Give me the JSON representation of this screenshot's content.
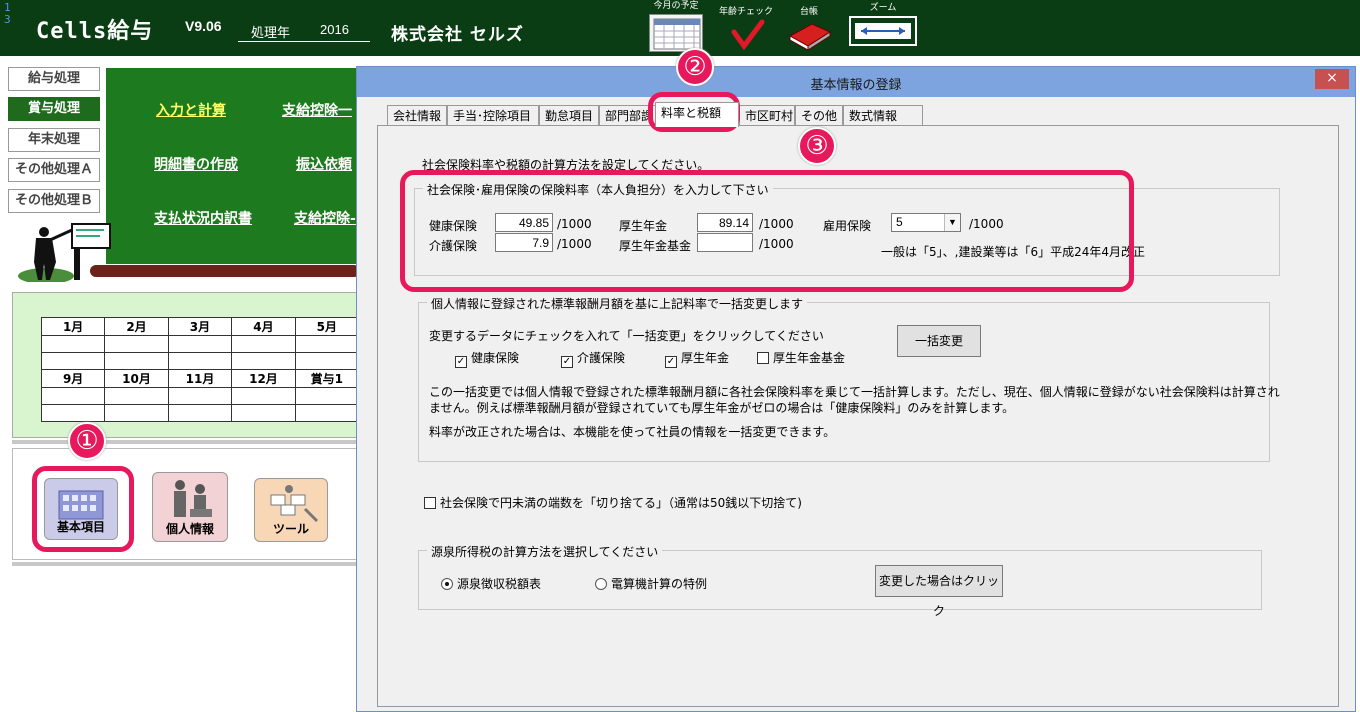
{
  "app": {
    "row_numbers": [
      "1",
      "3"
    ],
    "title": "Cells給与",
    "version": "V9.06",
    "year_label": "処理年",
    "year_value": "2016",
    "company": "株式会社 セルズ"
  },
  "toolbar": {
    "schedule_label": "今月の予定",
    "age_check_label": "年齢チェック",
    "ledger_label": "台帳",
    "zoom_label": "ズーム"
  },
  "nav": {
    "payroll": "給与処理",
    "bonus": "賞与処理",
    "yearend": "年末処理",
    "otherA": "その他処理Ａ",
    "otherB": "その他処理Ｂ"
  },
  "board": {
    "input_calc": "入力と計算",
    "ded_list": "支給控除一",
    "meisai": "明細書の作成",
    "furikomi": "振込依頼",
    "shiharai": "支払状況内訳書",
    "ded2": "支給控除-"
  },
  "calendar": {
    "row1": [
      "1月",
      "2月",
      "3月",
      "4月",
      "5月"
    ],
    "row2": [
      "9月",
      "10月",
      "11月",
      "12月",
      "賞与1"
    ]
  },
  "icons": {
    "kihon": "基本項目",
    "kojin": "個人情報",
    "tool": "ツール"
  },
  "callouts": {
    "n1": "①",
    "n2": "②",
    "n3": "③"
  },
  "dialog": {
    "title": "基本情報の登録",
    "close": "×",
    "tabs": [
      "会社情報",
      "手当･控除項目",
      "勤怠項目",
      "部門部課",
      "料率と税額",
      "市区町村",
      "その他",
      "数式情報"
    ],
    "intro": "社会保険料率や税額の計算方法を設定してください。",
    "rates": {
      "legend": "社会保険･雇用保険の保険料率（本人負担分）を入力して下さい",
      "health_label": "健康保険",
      "health_value": "49.85",
      "care_label": "介護保険",
      "care_value": "7.9",
      "pension_label": "厚生年金",
      "pension_value": "89.14",
      "fund_label": "厚生年金基金",
      "fund_value": "",
      "employ_label": "雇用保険",
      "employ_value": "5",
      "unit": "/1000",
      "employ_note": "一般は「5」、,建設業等は「6」平成24年4月改正"
    },
    "bulk": {
      "legend": "個人情報に登録された標準報酬月額を基に上記料率で一括変更します",
      "instruction": "変更するデータにチェックを入れて「一括変更」をクリックしてください",
      "checks": [
        {
          "label": "健康保険",
          "checked": true
        },
        {
          "label": "介護保険",
          "checked": true
        },
        {
          "label": "厚生年金",
          "checked": true
        },
        {
          "label": "厚生年金基金",
          "checked": false
        }
      ],
      "button": "一括変更",
      "note1": "この一括変更では個人情報で登録された標準報酬月額に各社会保険料率を乗じて一括計算します。ただし、現在、個人情報に登録がない社会保険料は計算され",
      "note2": "ません。例えば標準報酬月額が登録されていても厚生年金がゼロの場合は「健康保険料」のみを計算します。",
      "note3": "料率が改正された場合は、本機能を使って社員の情報を一括変更できます。"
    },
    "round_check": "社会保険で円未満の端数を「切り捨てる」（通常は50銭以下切捨て)",
    "tax": {
      "legend": "源泉所得税の計算方法を選択してください",
      "opt1": "源泉徴収税額表",
      "opt2": "電算機計算の特例",
      "selected": "源泉徴収税額表",
      "button": "変更した場合はクリック"
    }
  },
  "colors": {
    "accent": "#e8185c",
    "board": "#1e7a1e",
    "topbar": "#0b3d14",
    "titlebar": "#7da4df"
  }
}
